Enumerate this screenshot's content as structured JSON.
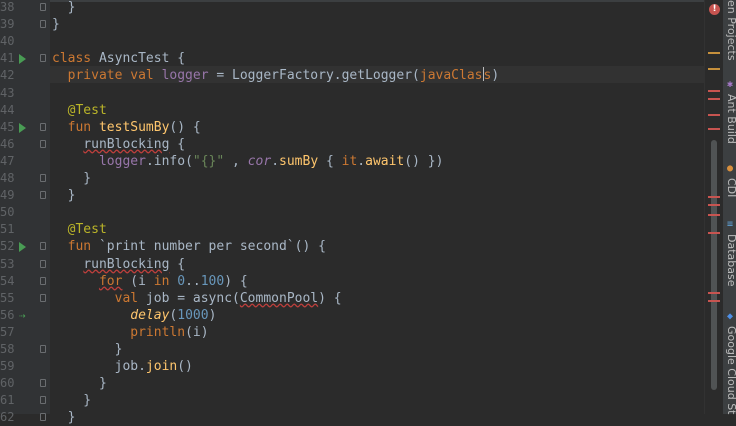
{
  "editor": {
    "lines": [
      {
        "num": "38",
        "html": "  }"
      },
      {
        "num": "39",
        "html": "}"
      },
      {
        "num": "40",
        "html": ""
      },
      {
        "num": "41",
        "html": "<span class=\"k\">class</span> AsyncTest {"
      },
      {
        "num": "42",
        "html": "  <span class=\"k\">private val</span> <span class=\"p\">logger</span> = LoggerFactory.getLogger(<span class=\"k\">javaClas</span><span class=\"caret\"></span><span class=\"k\">s</span>)"
      },
      {
        "num": "43",
        "html": ""
      },
      {
        "num": "44",
        "html": "  <span class=\"a\">@Test</span>"
      },
      {
        "num": "45",
        "html": "  <span class=\"k\">fun</span> <span class=\"fn\">testSumBy</span>() {"
      },
      {
        "num": "46",
        "html": "    <span class=\"sq\">runBlocking</span> {"
      },
      {
        "num": "47",
        "html": "      <span class=\"p\">logger</span>.info(<span class=\"s\">\"{}\"</span> , <span class=\"p i\">cor</span>.<span class=\"fn\">sumBy</span> { <span class=\"k\">it</span>.<span class=\"fn\">await</span>() })"
      },
      {
        "num": "48",
        "html": "    }"
      },
      {
        "num": "49",
        "html": "  }"
      },
      {
        "num": "50",
        "html": ""
      },
      {
        "num": "51",
        "html": "  <span class=\"a\">@Test</span>"
      },
      {
        "num": "52",
        "html": "  <span class=\"k\">fun</span> `print number per second`() {"
      },
      {
        "num": "53",
        "html": "    <span class=\"sq\">runBlocking</span> {"
      },
      {
        "num": "54",
        "html": "      <span class=\"k sq\">for</span> (i <span class=\"k\">in</span> <span class=\"n\">0</span>..<span class=\"n\">100</span>) {"
      },
      {
        "num": "55",
        "html": "        <span class=\"k\">val</span> job = async(<span class=\"sq\">CommonPool</span>) {"
      },
      {
        "num": "56",
        "html": "          <span class=\"fn i\">delay</span>(<span class=\"n\">1000</span>)"
      },
      {
        "num": "57",
        "html": "          <span class=\"k\">println</span>(i)"
      },
      {
        "num": "58",
        "html": "        }"
      },
      {
        "num": "59",
        "html": "        job.<span class=\"fn\">join</span>()"
      },
      {
        "num": "60",
        "html": "      }"
      },
      {
        "num": "61",
        "html": "    }"
      },
      {
        "num": "62",
        "html": "  }"
      }
    ]
  },
  "tool_windows": [
    {
      "label": "en Projects",
      "icon": "maven-icon",
      "color": "#8a9ec2"
    },
    {
      "label": "Ant Build",
      "icon": "ant-icon",
      "color": "#a679c9"
    },
    {
      "label": "CDI",
      "icon": "cdi-icon",
      "color": "#d88f3d"
    },
    {
      "label": "Database",
      "icon": "database-icon",
      "color": "#5f9ed1"
    },
    {
      "label": "Google Cloud St",
      "icon": "google-cloud-icon",
      "color": "#4e8fe6"
    }
  ],
  "error_marker": "!",
  "colors": {
    "background": "#2b2b2b",
    "gutter": "#313335",
    "keyword": "#cc7832",
    "string": "#6a8759",
    "number": "#6897bb",
    "property": "#9876aa",
    "function": "#ffc66d",
    "annotation": "#bbb529",
    "error": "#bc3f3c"
  }
}
